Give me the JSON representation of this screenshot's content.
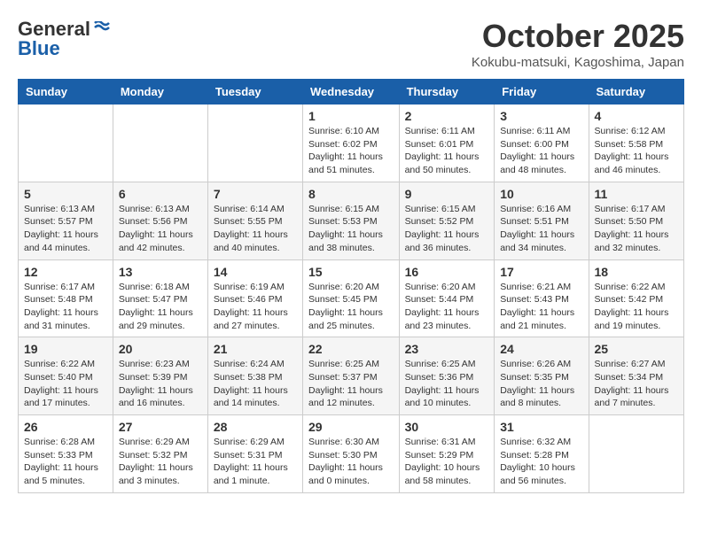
{
  "header": {
    "logo_general": "General",
    "logo_blue": "Blue",
    "month": "October 2025",
    "location": "Kokubu-matsuki, Kagoshima, Japan"
  },
  "weekdays": [
    "Sunday",
    "Monday",
    "Tuesday",
    "Wednesday",
    "Thursday",
    "Friday",
    "Saturday"
  ],
  "weeks": [
    [
      {
        "day": "",
        "info": ""
      },
      {
        "day": "",
        "info": ""
      },
      {
        "day": "",
        "info": ""
      },
      {
        "day": "1",
        "info": "Sunrise: 6:10 AM\nSunset: 6:02 PM\nDaylight: 11 hours\nand 51 minutes."
      },
      {
        "day": "2",
        "info": "Sunrise: 6:11 AM\nSunset: 6:01 PM\nDaylight: 11 hours\nand 50 minutes."
      },
      {
        "day": "3",
        "info": "Sunrise: 6:11 AM\nSunset: 6:00 PM\nDaylight: 11 hours\nand 48 minutes."
      },
      {
        "day": "4",
        "info": "Sunrise: 6:12 AM\nSunset: 5:58 PM\nDaylight: 11 hours\nand 46 minutes."
      }
    ],
    [
      {
        "day": "5",
        "info": "Sunrise: 6:13 AM\nSunset: 5:57 PM\nDaylight: 11 hours\nand 44 minutes."
      },
      {
        "day": "6",
        "info": "Sunrise: 6:13 AM\nSunset: 5:56 PM\nDaylight: 11 hours\nand 42 minutes."
      },
      {
        "day": "7",
        "info": "Sunrise: 6:14 AM\nSunset: 5:55 PM\nDaylight: 11 hours\nand 40 minutes."
      },
      {
        "day": "8",
        "info": "Sunrise: 6:15 AM\nSunset: 5:53 PM\nDaylight: 11 hours\nand 38 minutes."
      },
      {
        "day": "9",
        "info": "Sunrise: 6:15 AM\nSunset: 5:52 PM\nDaylight: 11 hours\nand 36 minutes."
      },
      {
        "day": "10",
        "info": "Sunrise: 6:16 AM\nSunset: 5:51 PM\nDaylight: 11 hours\nand 34 minutes."
      },
      {
        "day": "11",
        "info": "Sunrise: 6:17 AM\nSunset: 5:50 PM\nDaylight: 11 hours\nand 32 minutes."
      }
    ],
    [
      {
        "day": "12",
        "info": "Sunrise: 6:17 AM\nSunset: 5:48 PM\nDaylight: 11 hours\nand 31 minutes."
      },
      {
        "day": "13",
        "info": "Sunrise: 6:18 AM\nSunset: 5:47 PM\nDaylight: 11 hours\nand 29 minutes."
      },
      {
        "day": "14",
        "info": "Sunrise: 6:19 AM\nSunset: 5:46 PM\nDaylight: 11 hours\nand 27 minutes."
      },
      {
        "day": "15",
        "info": "Sunrise: 6:20 AM\nSunset: 5:45 PM\nDaylight: 11 hours\nand 25 minutes."
      },
      {
        "day": "16",
        "info": "Sunrise: 6:20 AM\nSunset: 5:44 PM\nDaylight: 11 hours\nand 23 minutes."
      },
      {
        "day": "17",
        "info": "Sunrise: 6:21 AM\nSunset: 5:43 PM\nDaylight: 11 hours\nand 21 minutes."
      },
      {
        "day": "18",
        "info": "Sunrise: 6:22 AM\nSunset: 5:42 PM\nDaylight: 11 hours\nand 19 minutes."
      }
    ],
    [
      {
        "day": "19",
        "info": "Sunrise: 6:22 AM\nSunset: 5:40 PM\nDaylight: 11 hours\nand 17 minutes."
      },
      {
        "day": "20",
        "info": "Sunrise: 6:23 AM\nSunset: 5:39 PM\nDaylight: 11 hours\nand 16 minutes."
      },
      {
        "day": "21",
        "info": "Sunrise: 6:24 AM\nSunset: 5:38 PM\nDaylight: 11 hours\nand 14 minutes."
      },
      {
        "day": "22",
        "info": "Sunrise: 6:25 AM\nSunset: 5:37 PM\nDaylight: 11 hours\nand 12 minutes."
      },
      {
        "day": "23",
        "info": "Sunrise: 6:25 AM\nSunset: 5:36 PM\nDaylight: 11 hours\nand 10 minutes."
      },
      {
        "day": "24",
        "info": "Sunrise: 6:26 AM\nSunset: 5:35 PM\nDaylight: 11 hours\nand 8 minutes."
      },
      {
        "day": "25",
        "info": "Sunrise: 6:27 AM\nSunset: 5:34 PM\nDaylight: 11 hours\nand 7 minutes."
      }
    ],
    [
      {
        "day": "26",
        "info": "Sunrise: 6:28 AM\nSunset: 5:33 PM\nDaylight: 11 hours\nand 5 minutes."
      },
      {
        "day": "27",
        "info": "Sunrise: 6:29 AM\nSunset: 5:32 PM\nDaylight: 11 hours\nand 3 minutes."
      },
      {
        "day": "28",
        "info": "Sunrise: 6:29 AM\nSunset: 5:31 PM\nDaylight: 11 hours\nand 1 minute."
      },
      {
        "day": "29",
        "info": "Sunrise: 6:30 AM\nSunset: 5:30 PM\nDaylight: 11 hours\nand 0 minutes."
      },
      {
        "day": "30",
        "info": "Sunrise: 6:31 AM\nSunset: 5:29 PM\nDaylight: 10 hours\nand 58 minutes."
      },
      {
        "day": "31",
        "info": "Sunrise: 6:32 AM\nSunset: 5:28 PM\nDaylight: 10 hours\nand 56 minutes."
      },
      {
        "day": "",
        "info": ""
      }
    ]
  ]
}
